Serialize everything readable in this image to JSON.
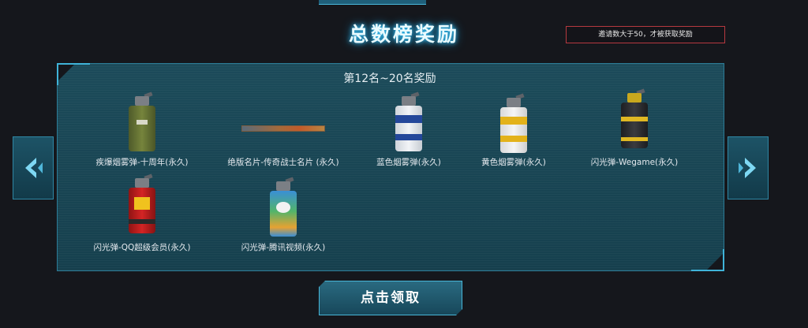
{
  "header": {
    "title": "总数榜奖励"
  },
  "notice": {
    "text": "邀请数大于50，才被获取奖励"
  },
  "panel": {
    "subtitle": "第12名~20名奖励",
    "items": [
      {
        "label": "疾爆烟雾弹-十周年(永久)",
        "icon": "smoke-grenade-tenth-anniversary-icon"
      },
      {
        "label": "绝版名片-传奇战士名片 (永久)",
        "icon": "name-card-legendary-warrior-icon"
      },
      {
        "label": "蓝色烟雾弹(永久)",
        "icon": "blue-smoke-grenade-icon"
      },
      {
        "label": "黄色烟雾弹(永久)",
        "icon": "yellow-smoke-grenade-icon"
      },
      {
        "label": "闪光弹-Wegame(永久)",
        "icon": "flash-grenade-wegame-icon"
      },
      {
        "label": "闪光弹-QQ超级会员(永久)",
        "icon": "flash-grenade-qq-svip-icon"
      },
      {
        "label": "闪光弹-腾讯视频(永久)",
        "icon": "flash-grenade-tencent-video-icon"
      }
    ]
  },
  "nav": {
    "prev_icon": "chevron-left-icon",
    "next_icon": "chevron-right-icon"
  },
  "claim_button": {
    "label": "点击领取"
  },
  "colors": {
    "accent": "#3fb3d8",
    "panel_bg": "#1a4654",
    "notice_border": "#b6393f",
    "title_glow": "#38c8ff"
  }
}
